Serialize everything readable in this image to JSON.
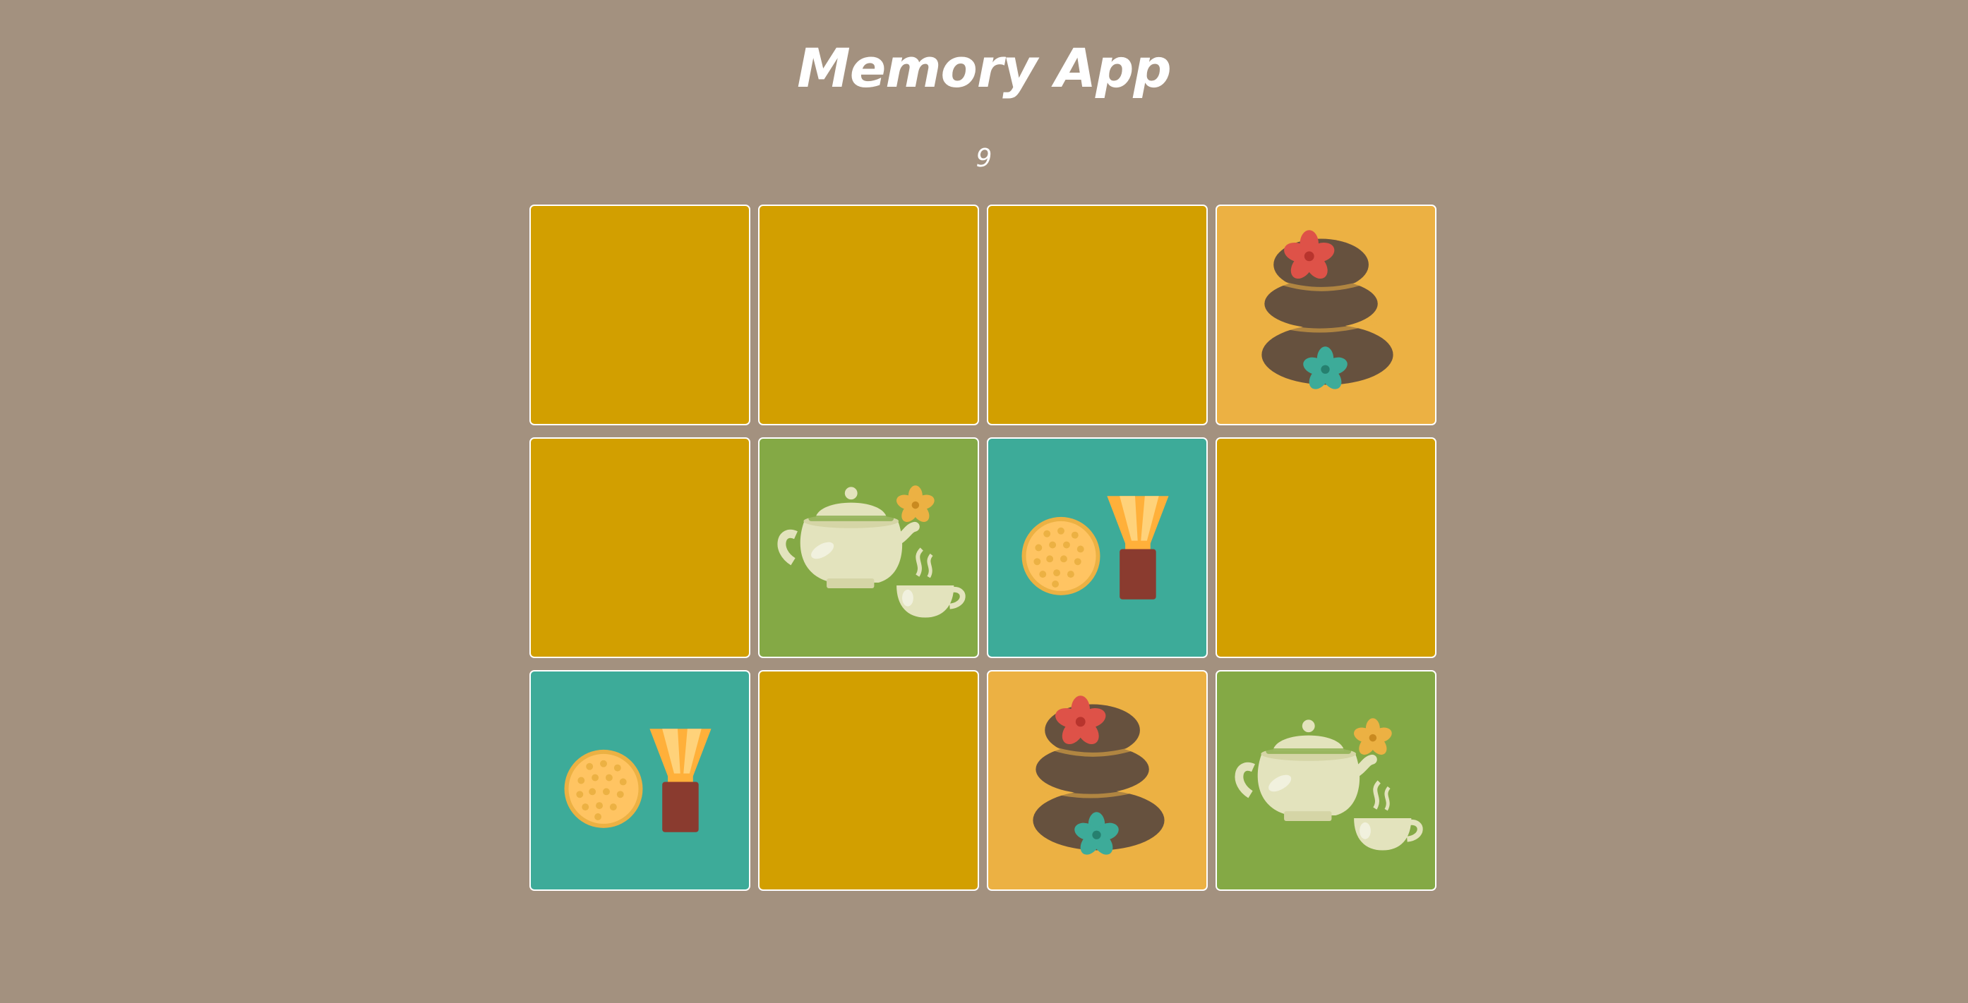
{
  "app": {
    "title": "Memory App",
    "counter": "9"
  },
  "colors": {
    "background": "#a3917f",
    "card_back": "#d29f00",
    "stones": "#ecb143",
    "tea": "#84a945",
    "whisk": "#3dab99",
    "border": "#ffffff"
  },
  "cards": [
    {
      "state": "face-down",
      "icon": "card-back"
    },
    {
      "state": "face-down",
      "icon": "card-back"
    },
    {
      "state": "face-down",
      "icon": "card-back"
    },
    {
      "state": "face-up",
      "icon": "spa-stones-icon"
    },
    {
      "state": "face-down",
      "icon": "card-back"
    },
    {
      "state": "face-up",
      "icon": "teapot-icon"
    },
    {
      "state": "face-up",
      "icon": "matcha-whisk-icon"
    },
    {
      "state": "face-down",
      "icon": "card-back"
    },
    {
      "state": "face-up",
      "icon": "matcha-whisk-icon"
    },
    {
      "state": "face-down",
      "icon": "card-back"
    },
    {
      "state": "face-up",
      "icon": "spa-stones-icon"
    },
    {
      "state": "face-up",
      "icon": "teapot-icon"
    }
  ]
}
